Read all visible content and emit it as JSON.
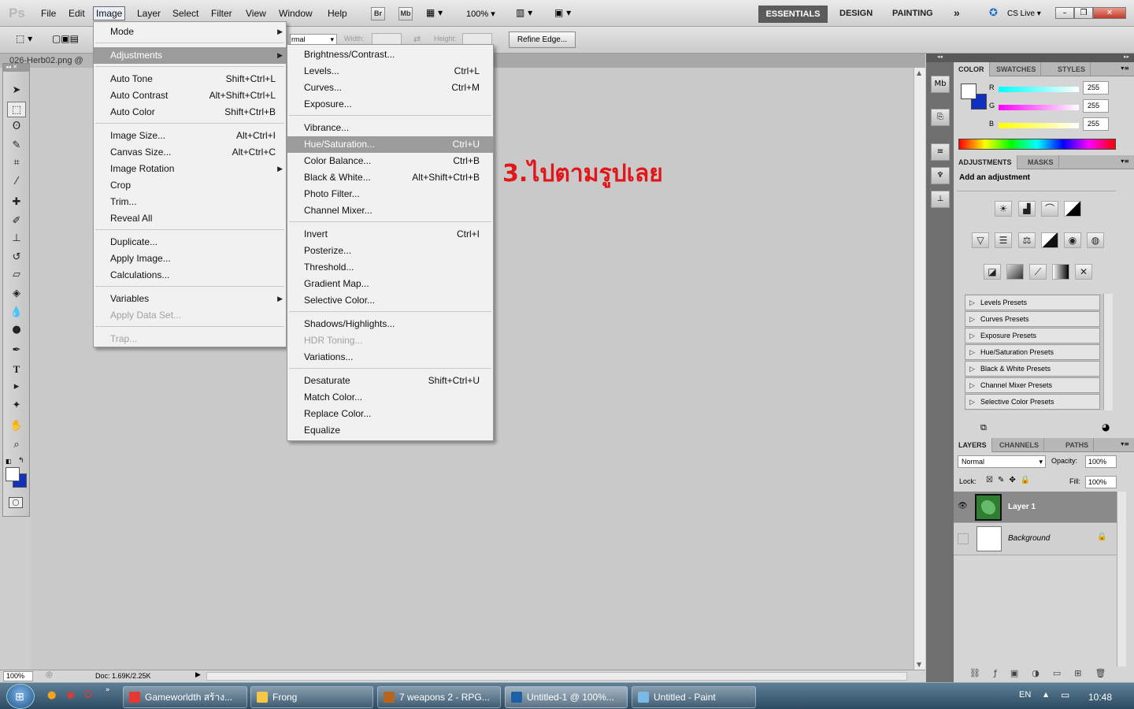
{
  "app": {
    "logo": "Ps"
  },
  "menubar": [
    "File",
    "Edit",
    "Image",
    "Layer",
    "Select",
    "Filter",
    "View",
    "Window",
    "Help"
  ],
  "appbar": {
    "bridge": "Br",
    "minibridge": "Mb",
    "zoom": "100%",
    "workspaces": {
      "essentials": "ESSENTIALS",
      "design": "DESIGN",
      "painting": "PAINTING",
      "more": "»"
    },
    "cs_live": "CS Live"
  },
  "options": {
    "style_value": "rmal",
    "width_label": "Width:",
    "height_label": "Height:",
    "refine_edge": "Refine Edge..."
  },
  "document": {
    "tab": "026-Herb02.png @",
    "zoom": "100%",
    "doc_info": "Doc: 1.69K/2.25K"
  },
  "image_menu": {
    "items": [
      {
        "label": "Mode",
        "shortcut": "",
        "submenu": true
      },
      {
        "label": "Adjustments",
        "shortcut": "",
        "submenu": true,
        "highlighted": true
      },
      {
        "label": "Auto Tone",
        "shortcut": "Shift+Ctrl+L"
      },
      {
        "label": "Auto Contrast",
        "shortcut": "Alt+Shift+Ctrl+L"
      },
      {
        "label": "Auto Color",
        "shortcut": "Shift+Ctrl+B"
      },
      {
        "label": "Image Size...",
        "shortcut": "Alt+Ctrl+I"
      },
      {
        "label": "Canvas Size...",
        "shortcut": "Alt+Ctrl+C"
      },
      {
        "label": "Image Rotation",
        "shortcut": "",
        "submenu": true
      },
      {
        "label": "Crop",
        "shortcut": ""
      },
      {
        "label": "Trim...",
        "shortcut": ""
      },
      {
        "label": "Reveal All",
        "shortcut": ""
      },
      {
        "label": "Duplicate...",
        "shortcut": ""
      },
      {
        "label": "Apply Image...",
        "shortcut": ""
      },
      {
        "label": "Calculations...",
        "shortcut": ""
      },
      {
        "label": "Variables",
        "shortcut": "",
        "submenu": true
      },
      {
        "label": "Apply Data Set...",
        "shortcut": "",
        "disabled": true
      },
      {
        "label": "Trap...",
        "shortcut": "",
        "disabled": true
      }
    ]
  },
  "adjustments_menu": {
    "items": [
      {
        "label": "Brightness/Contrast...",
        "shortcut": ""
      },
      {
        "label": "Levels...",
        "shortcut": "Ctrl+L"
      },
      {
        "label": "Curves...",
        "shortcut": "Ctrl+M"
      },
      {
        "label": "Exposure...",
        "shortcut": ""
      },
      {
        "label": "Vibrance...",
        "shortcut": ""
      },
      {
        "label": "Hue/Saturation...",
        "shortcut": "Ctrl+U",
        "highlighted": true
      },
      {
        "label": "Color Balance...",
        "shortcut": "Ctrl+B"
      },
      {
        "label": "Black & White...",
        "shortcut": "Alt+Shift+Ctrl+B"
      },
      {
        "label": "Photo Filter...",
        "shortcut": ""
      },
      {
        "label": "Channel Mixer...",
        "shortcut": ""
      },
      {
        "label": "Invert",
        "shortcut": "Ctrl+I"
      },
      {
        "label": "Posterize...",
        "shortcut": ""
      },
      {
        "label": "Threshold...",
        "shortcut": ""
      },
      {
        "label": "Gradient Map...",
        "shortcut": ""
      },
      {
        "label": "Selective Color...",
        "shortcut": ""
      },
      {
        "label": "Shadows/Highlights...",
        "shortcut": ""
      },
      {
        "label": "HDR Toning...",
        "shortcut": "",
        "disabled": true
      },
      {
        "label": "Variations...",
        "shortcut": ""
      },
      {
        "label": "Desaturate",
        "shortcut": "Shift+Ctrl+U"
      },
      {
        "label": "Match Color...",
        "shortcut": ""
      },
      {
        "label": "Replace Color...",
        "shortcut": ""
      },
      {
        "label": "Equalize",
        "shortcut": ""
      }
    ]
  },
  "annotation": "3.ไปตามรูปเลย",
  "color_panel": {
    "tabs": [
      "COLOR",
      "SWATCHES",
      "STYLES"
    ],
    "channels": [
      {
        "label": "R",
        "value": "255"
      },
      {
        "label": "G",
        "value": "255"
      },
      {
        "label": "B",
        "value": "255"
      }
    ],
    "foreground": "#ffffff",
    "background": "#1030c0"
  },
  "adjustments_panel": {
    "tabs": [
      "ADJUSTMENTS",
      "MASKS"
    ],
    "heading": "Add an adjustment",
    "presets": [
      "Levels Presets",
      "Curves Presets",
      "Exposure Presets",
      "Hue/Saturation Presets",
      "Black & White Presets",
      "Channel Mixer Presets",
      "Selective Color Presets"
    ]
  },
  "layers_panel": {
    "tabs": [
      "LAYERS",
      "CHANNELS",
      "PATHS"
    ],
    "blend_mode": "Normal",
    "opacity_label": "Opacity:",
    "opacity": "100%",
    "lock_label": "Lock:",
    "fill_label": "Fill:",
    "fill": "100%",
    "layers": [
      {
        "name": "Layer 1",
        "selected": true
      },
      {
        "name": "Background",
        "locked": true
      }
    ]
  },
  "taskbar": {
    "tasks": [
      "Gameworldth สร้าง...",
      "Frong",
      "7 weapons 2 - RPG...",
      "Untitled-1 @ 100%...",
      "Untitled - Paint"
    ],
    "language": "EN",
    "clock": "10:48"
  }
}
